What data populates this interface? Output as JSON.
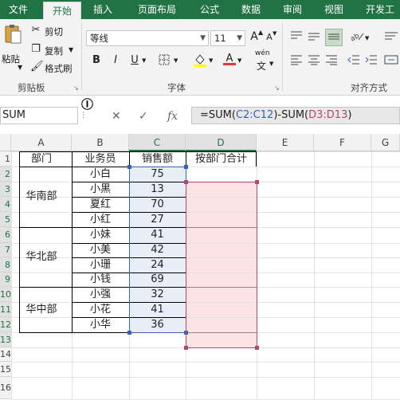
{
  "ribbon": {
    "tabs": [
      {
        "label": "文件",
        "active": false
      },
      {
        "label": "开始",
        "active": true
      },
      {
        "label": "插入",
        "active": false
      },
      {
        "label": "页面布局",
        "active": false
      },
      {
        "label": "公式",
        "active": false
      },
      {
        "label": "数据",
        "active": false
      },
      {
        "label": "审阅",
        "active": false
      },
      {
        "label": "视图",
        "active": false
      },
      {
        "label": "开发工",
        "active": false
      }
    ],
    "clipboard": {
      "paste": "粘贴",
      "cut": "剪切",
      "copy": "复制",
      "format_painter": "格式刷",
      "group": "剪贴板"
    },
    "font": {
      "name": "等线",
      "size": "11",
      "bold": "B",
      "italic": "I",
      "underline": "U",
      "grow": "A",
      "shrink": "A",
      "font_color": "A",
      "phonetic": "wén",
      "group": "字体"
    },
    "alignment": {
      "group": "对齐方式"
    }
  },
  "formula_bar": {
    "name_box": "SUM",
    "cancel": "✕",
    "enter": "✓",
    "fx": "fx",
    "formula_prefix": "=SUM(",
    "ref1": "C2:C12",
    "formula_mid": ")-SUM(",
    "ref2": "D3:D13",
    "formula_suffix": ")"
  },
  "columns": [
    "A",
    "B",
    "C",
    "D",
    "E",
    "F",
    "G"
  ],
  "rows": [
    "1",
    "2",
    "3",
    "4",
    "5",
    "6",
    "7",
    "8",
    "9",
    "10",
    "11",
    "12",
    "13",
    "14",
    "15",
    "16"
  ],
  "headers": {
    "dept": "部门",
    "staff": "业务员",
    "sales": "销售额",
    "total": "按部门合计"
  },
  "departments": [
    "华南部",
    "华北部",
    "华中部"
  ],
  "staff": [
    "小白",
    "小黑",
    "夏红",
    "小红",
    "小妹",
    "小美",
    "小珊",
    "小钱",
    "小强",
    "小花",
    "小华"
  ],
  "sales": [
    "75",
    "13",
    "70",
    "27",
    "41",
    "42",
    "24",
    "69",
    "32",
    "41",
    "36"
  ],
  "colors": {
    "accent": "#217346",
    "ref1": "#3a62b0",
    "ref2": "#b04a6a",
    "sel_fill": "#e8eef8",
    "ref2_fill": "#fbe3e6"
  }
}
